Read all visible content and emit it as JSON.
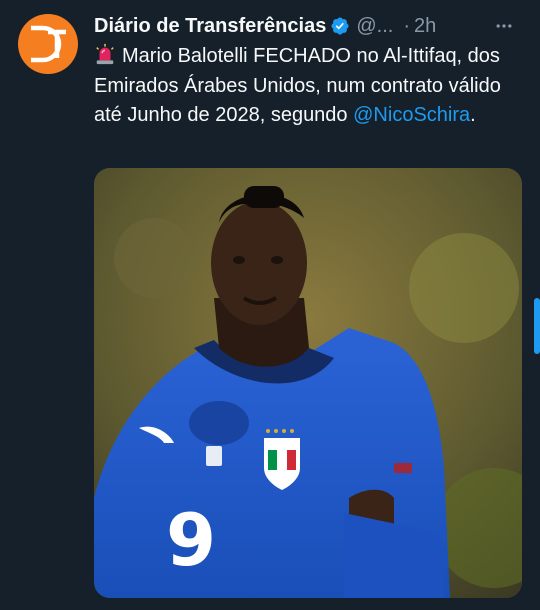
{
  "tweet": {
    "author": "Diário de Transferências",
    "handle": "@...",
    "separator": "·",
    "time": "2h",
    "more_label": "···",
    "avatar_initials": "DT",
    "text_main": "Mario Balotelli FECHADO no Al-Ittifaq, dos Emirados Árabes Unidos, num contrato válido até Junho de 2028, segundo ",
    "mention": "@NicoSchira",
    "text_end": ".",
    "jersey_number": "9"
  },
  "colors": {
    "background": "#15202b",
    "accent": "#1d9bf0",
    "avatar": "#f57f20",
    "jersey": "#1f56c8"
  },
  "icons": {
    "verified": "verified-badge-icon",
    "siren": "police-siren-emoji-icon",
    "more": "more-options-icon"
  }
}
